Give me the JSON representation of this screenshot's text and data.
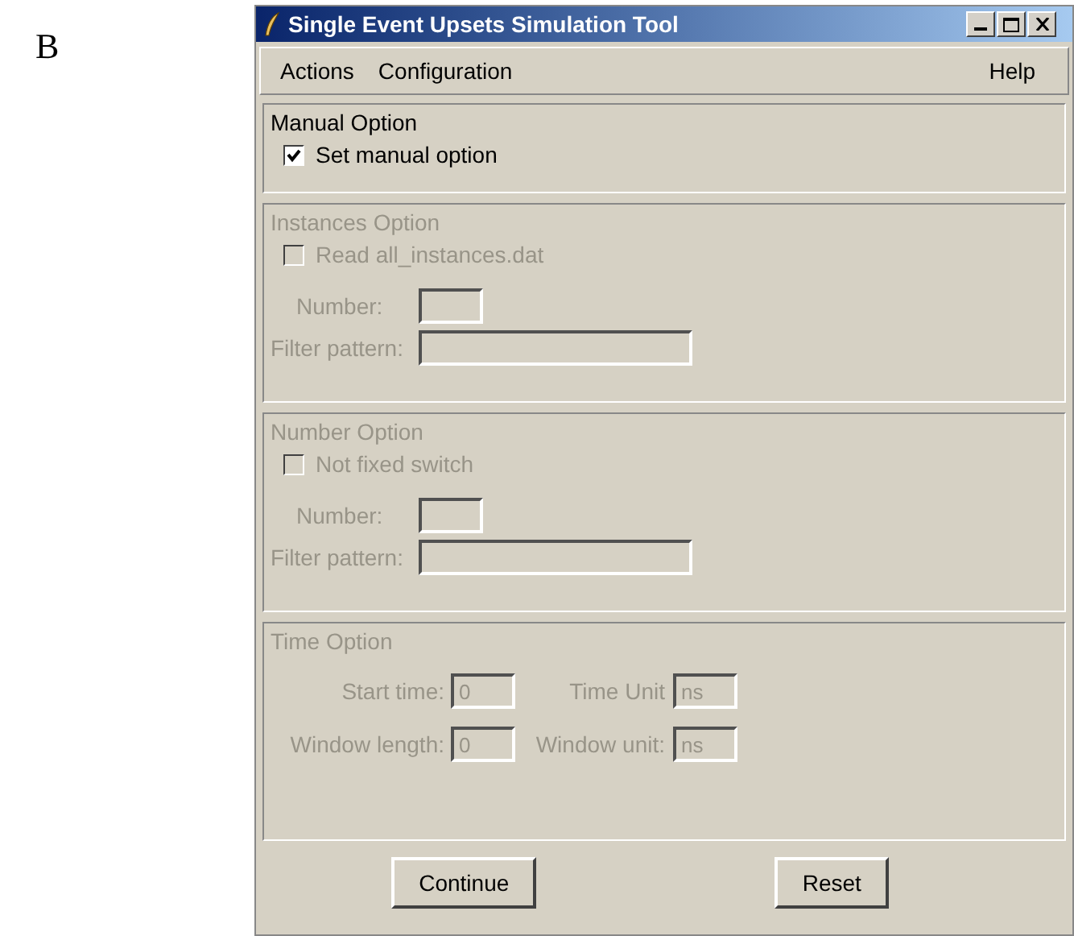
{
  "figure_label": "B",
  "window": {
    "title": "Single Event Upsets Simulation Tool"
  },
  "menu": {
    "left": [
      "Actions",
      "Configuration"
    ],
    "right": [
      "Help"
    ]
  },
  "sections": [
    {
      "title": "Manual Option",
      "disabled": false,
      "rows": [
        {
          "kind": "checkbox",
          "label": "Set manual option",
          "checked": true
        }
      ]
    },
    {
      "title": "Instances Option",
      "disabled": true,
      "rows": [
        {
          "kind": "checkbox",
          "label": "Read all_instances.dat",
          "checked": false
        },
        {
          "kind": "number",
          "fields": [
            {
              "label": "Number:"
            }
          ]
        },
        {
          "kind": "pattern",
          "fields": [
            {
              "label": "Filter pattern:"
            }
          ]
        }
      ]
    },
    {
      "title": "Number Option",
      "disabled": true,
      "rows": [
        {
          "kind": "checkbox",
          "label": "Not fixed switch",
          "checked": false
        },
        {
          "kind": "number",
          "fields": [
            {
              "label": "Number:"
            }
          ]
        },
        {
          "kind": "pattern",
          "fields": [
            {
              "label": "Filter pattern:"
            }
          ]
        }
      ]
    },
    {
      "title": "Time Option",
      "disabled": true,
      "rows": [
        {
          "kind": "time",
          "fields": [
            {
              "label": "Start time:",
              "value": "0"
            },
            {
              "label": "Time Unit",
              "value": "ns"
            }
          ]
        },
        {
          "kind": "time",
          "fields": [
            {
              "label": "Window length:",
              "value": "0"
            },
            {
              "label": "Window unit:",
              "value": "ns"
            }
          ]
        }
      ]
    }
  ],
  "buttons": [
    "Continue",
    "Reset"
  ]
}
